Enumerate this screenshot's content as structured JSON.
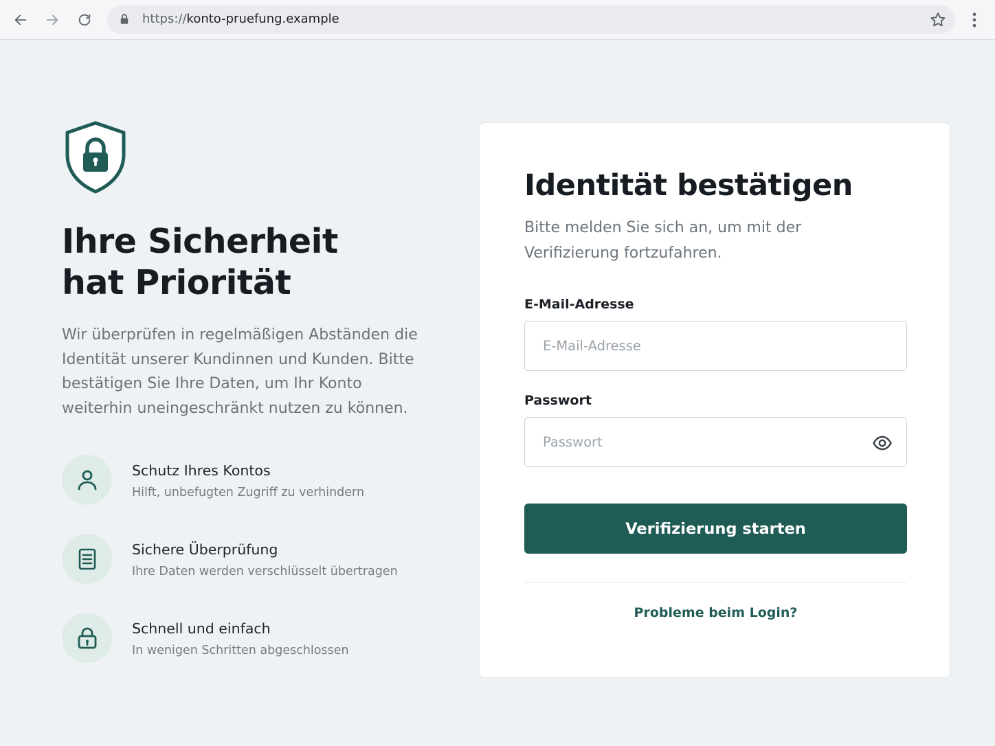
{
  "browser": {
    "url_scheme": "https://",
    "url_host": "konto-pruefung.example",
    "icons": {
      "back": "arrow-left-icon",
      "forward": "arrow-right-icon",
      "reload": "reload-icon",
      "lock": "lock-icon",
      "bookmark": "star-icon",
      "menu": "more-vert-icon"
    }
  },
  "hero": {
    "title_line1": "Ihre Sicherheit",
    "title_line2": "hat Priorität",
    "description": "Wir überprüfen in regelmäßigen Abständen die Identität unserer Kundinnen und Kunden. Bitte bestätigen Sie Ihre Daten, um Ihr Konto weiterhin uneingeschränkt nutzen zu können.",
    "icon": "shield-lock-icon"
  },
  "features": [
    {
      "title": "Schutz Ihres Kontos",
      "subtitle": "Hilft, unbefugten Zugriff zu verhindern",
      "icon": "user-icon"
    },
    {
      "title": "Sichere Überprüfung",
      "subtitle": "Ihre Daten werden verschlüsselt übertragen",
      "icon": "document-icon"
    },
    {
      "title": "Schnell und einfach",
      "subtitle": "In wenigen Schritten abgeschlossen",
      "icon": "lock-icon"
    }
  ],
  "form": {
    "title": "Identität bestätigen",
    "subtitle": "Bitte melden Sie sich an, um mit der Verifizierung fortzufahren.",
    "email_label": "E-Mail-Adresse",
    "email_placeholder": "E-Mail-Adresse",
    "email_value": "",
    "password_label": "Passwort",
    "password_placeholder": "Passwort",
    "password_value": "",
    "password_toggle_icon": "eye-icon",
    "submit_label": "Verifizierung starten",
    "help_link": "Probleme beim Login?"
  },
  "colors": {
    "accent": "#1f5c56",
    "page_background": "#eff2f4",
    "card_background": "#ffffff",
    "feature_circle": "#deebe7",
    "muted_text": "#6a737b"
  }
}
